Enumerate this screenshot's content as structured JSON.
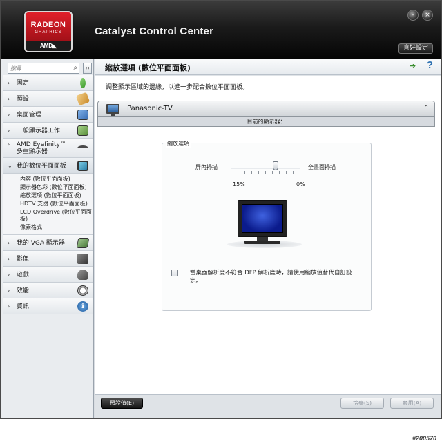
{
  "window": {
    "app_title": "Catalyst Control Center",
    "prefs_label": "喜好設定",
    "logo": {
      "line1": "RADEON",
      "line2": "GRAPHICS",
      "line3": "AMD◣"
    }
  },
  "sidebar": {
    "search_placeholder": "搜尋",
    "collapse_label": "‹‹",
    "items": [
      {
        "label": "固定",
        "arrow": "›",
        "icon": "pin-icon",
        "color": "#3a9a2a"
      },
      {
        "label": "預設",
        "arrow": "›",
        "icon": "presets-icon",
        "color": "#c98a2a"
      },
      {
        "label": "桌面管理",
        "arrow": "›",
        "icon": "desktop-manage-icon",
        "color": "#3b6fb5"
      },
      {
        "label": "一般顯示器工作",
        "arrow": "›",
        "icon": "display-tasks-icon",
        "color": "#5a8f3a"
      },
      {
        "label": "AMD Eyefinity™\n多重顯示器",
        "arrow": "›",
        "icon": "eyefinity-icon",
        "color": "#4a4a4a"
      },
      {
        "label": "我的數位平面面板",
        "arrow": "⌄",
        "icon": "flat-panel-icon",
        "color": "#2d7fa8"
      },
      {
        "label": "我的 VGA 顯示器",
        "arrow": "›",
        "icon": "vga-display-icon",
        "color": "#4a7a3a"
      },
      {
        "label": "影像",
        "arrow": "›",
        "icon": "video-icon",
        "color": "#444444"
      },
      {
        "label": "遊戲",
        "arrow": "›",
        "icon": "gaming-icon",
        "color": "#555555"
      },
      {
        "label": "效能",
        "arrow": "›",
        "icon": "performance-icon",
        "color": "#666666"
      },
      {
        "label": "資訊",
        "arrow": "›",
        "icon": "info-icon",
        "color": "#2a6fb0"
      }
    ],
    "sub_items": [
      "內容 (數位平面面板)",
      "顯示器色彩 (數位平面面板)",
      "縮放選項 (數位平面面板)",
      "HDTV 支援 (數位平面面板)",
      "LCD Overdrive (數位平面面板)",
      "像素格式"
    ]
  },
  "main": {
    "title": "縮放選項 (數位平面面板)",
    "description": "調整顯示區域的邊緣，以進一步配合數位平面面板。",
    "display_name": "Panasonic-TV",
    "current_display_label": "目前的顯示器：",
    "group_title": "縮放選項",
    "slider": {
      "left_label": "屏內掃描",
      "right_label": "全畫面掃描",
      "left_value": "15%",
      "right_value": "0%",
      "position": 0.64
    },
    "checkbox_label": "當桌面解析度不符合 DFP 解析度時，請使用縮放值替代自訂設定。",
    "checkbox_checked": false
  },
  "footer": {
    "defaults_label": "預設值(E)",
    "discard_label": "捨棄(S)",
    "apply_label": "套用(A)"
  },
  "watermark": "#200570"
}
